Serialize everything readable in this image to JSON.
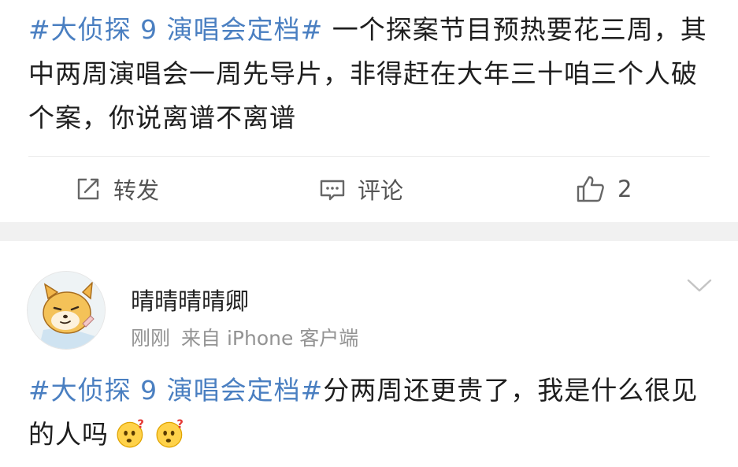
{
  "post": {
    "hashtag": "#大侦探 9 演唱会定档#",
    "text": " 一个探案节目预热要花三周，其中两周演唱会一周先导片，非得赶在大年三十咱三个人破个案，你说离谱不离谱",
    "actions": {
      "repost_label": "转发",
      "comment_label": "评论",
      "like_count": "2"
    }
  },
  "comment": {
    "username": "晴晴晴晴卿",
    "time": "刚刚",
    "source": "来自 iPhone 客户端",
    "hashtag": "#大侦探 9 演唱会定档#",
    "text": "分两周还更贵了，我是什么很见的人吗",
    "emoji": [
      "thinking-face",
      "thinking-face"
    ]
  },
  "colors": {
    "hashtag": "#4a7fc1",
    "text": "#1e1e1e",
    "meta": "#939393",
    "separator": "#f1f1f1"
  }
}
